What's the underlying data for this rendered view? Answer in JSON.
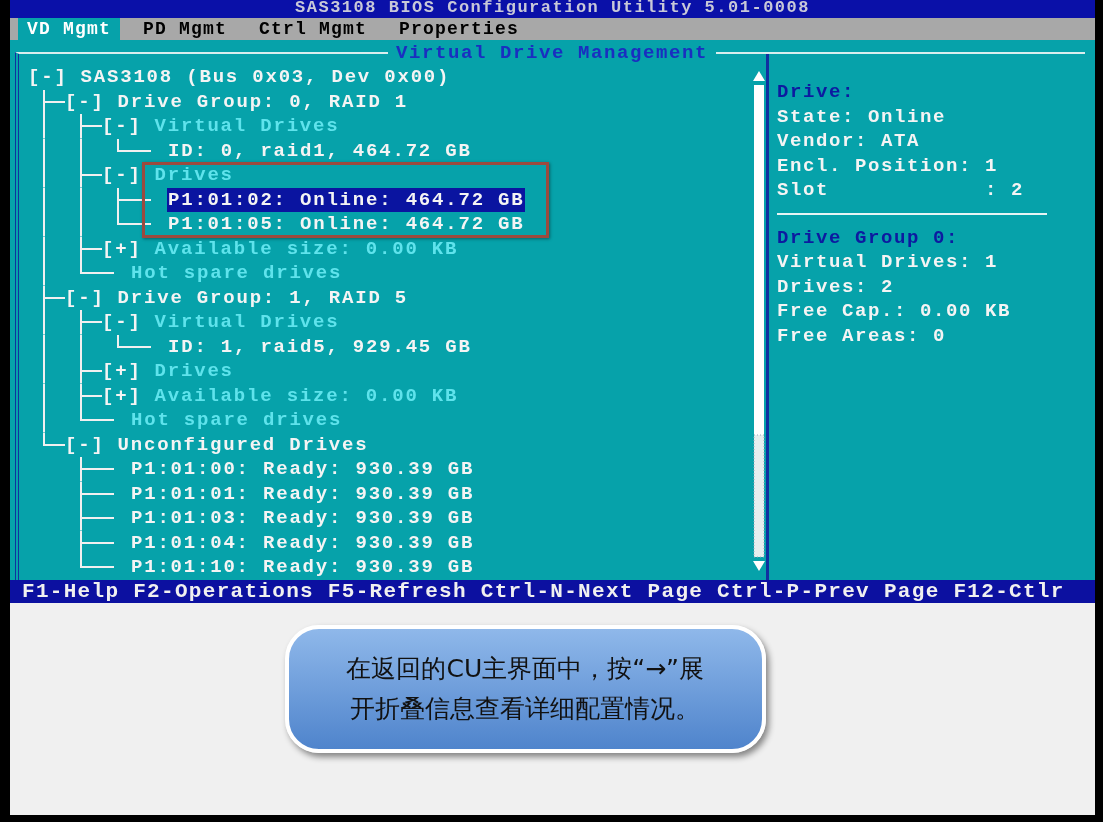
{
  "window": {
    "title": "SAS3108 BIOS Configuration Utility 5.01-0008"
  },
  "tabs": [
    {
      "label": "VD Mgmt",
      "selected": true
    },
    {
      "label": "PD Mgmt",
      "selected": false
    },
    {
      "label": "Ctrl Mgmt",
      "selected": false
    },
    {
      "label": "Properties",
      "selected": false
    }
  ],
  "frame_title": "Virtual Drive Management",
  "tree": {
    "toggle": "[-]",
    "label": "SAS3108 (Bus 0x03, Dev 0x00)",
    "kind": "item",
    "selected": false,
    "annotated": false,
    "children": [
      {
        "toggle": "[-]",
        "label": "Drive Group: 0, RAID 1",
        "kind": "item",
        "selected": false,
        "annotated": false,
        "children": [
          {
            "toggle": "[-]",
            "label": "Virtual Drives",
            "kind": "category",
            "selected": false,
            "annotated": false,
            "children": [
              {
                "label": "ID: 0, raid1, 464.72 GB",
                "kind": "item",
                "selected": false,
                "annotated": false
              }
            ]
          },
          {
            "toggle": "[-]",
            "label": "Drives",
            "kind": "category",
            "selected": false,
            "annotated": true,
            "children": [
              {
                "label": "P1:01:02: Online: 464.72 GB",
                "kind": "item",
                "selected": true,
                "annotated": false
              },
              {
                "label": "P1:01:05: Online: 464.72 GB",
                "kind": "item",
                "selected": false,
                "annotated": false
              }
            ]
          },
          {
            "toggle": "[+]",
            "label": "Available size: 0.00 KB",
            "kind": "category",
            "selected": false,
            "annotated": false
          },
          {
            "label": "Hot spare drives",
            "kind": "category",
            "selected": false,
            "annotated": false
          }
        ]
      },
      {
        "toggle": "[-]",
        "label": "Drive Group: 1, RAID 5",
        "kind": "item",
        "selected": false,
        "annotated": false,
        "children": [
          {
            "toggle": "[-]",
            "label": "Virtual Drives",
            "kind": "category",
            "selected": false,
            "annotated": false,
            "children": [
              {
                "label": "ID: 1, raid5, 929.45 GB",
                "kind": "item",
                "selected": false,
                "annotated": false
              }
            ]
          },
          {
            "toggle": "[+]",
            "label": "Drives",
            "kind": "category",
            "selected": false,
            "annotated": false
          },
          {
            "toggle": "[+]",
            "label": "Available size: 0.00 KB",
            "kind": "category",
            "selected": false,
            "annotated": false
          },
          {
            "label": "Hot spare drives",
            "kind": "category",
            "selected": false,
            "annotated": false
          }
        ]
      },
      {
        "toggle": "[-]",
        "label": "Unconfigured Drives",
        "kind": "item",
        "selected": false,
        "annotated": false,
        "children": [
          {
            "label": "P1:01:00: Ready: 930.39 GB",
            "kind": "item",
            "selected": false,
            "annotated": false
          },
          {
            "label": "P1:01:01: Ready: 930.39 GB",
            "kind": "item",
            "selected": false,
            "annotated": false
          },
          {
            "label": "P1:01:03: Ready: 930.39 GB",
            "kind": "item",
            "selected": false,
            "annotated": false
          },
          {
            "label": "P1:01:04: Ready: 930.39 GB",
            "kind": "item",
            "selected": false,
            "annotated": false
          },
          {
            "label": "P1:01:10: Ready: 930.39 GB",
            "kind": "item",
            "selected": false,
            "annotated": false
          }
        ]
      }
    ]
  },
  "details": [
    {
      "heading": "Drive:",
      "lines": [
        "State: Online",
        "Vendor: ATA",
        "Encl. Position: 1",
        "Slot            : 2"
      ]
    },
    {
      "heading": "Drive Group 0:",
      "lines": [
        "Virtual Drives: 1",
        "Drives: 2",
        "Free Cap.: 0.00 KB",
        "Free Areas: 0"
      ]
    }
  ],
  "status_bar": "F1-Help F2-Operations F5-Refresh Ctrl-N-Next Page Ctrl-P-Prev Page F12-Ctlr",
  "callout": "在返回的CU主界面中，按“→”展开折叠信息查看详细配置情况。"
}
